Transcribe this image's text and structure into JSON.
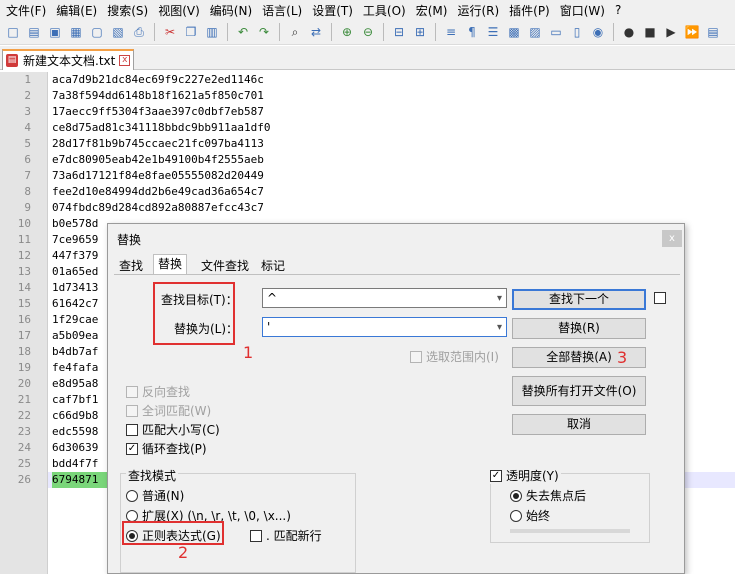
{
  "menu": [
    "文件(F)",
    "编辑(E)",
    "搜索(S)",
    "视图(V)",
    "编码(N)",
    "语言(L)",
    "设置(T)",
    "工具(O)",
    "宏(M)",
    "运行(R)",
    "插件(P)",
    "窗口(W)",
    "?"
  ],
  "tab": {
    "label": "新建文本文档.txt",
    "close": "x"
  },
  "lines": [
    "aca7d9b21dc84ec69f9c227e2ed1146c",
    "7a38f594dd6148b18f1621a5f850c701",
    "17aecc9ff5304f3aae397c0dbf7eb587",
    "ce8d75ad81c341118bbdc9bb911aa1df0",
    "28d17f81b9b745ccaec21fc097ba4113",
    "e7dc80905eab42e1b49100b4f2555aeb",
    "73a6d17121f84e8fae05555082d20449",
    "fee2d10e84994dd2b6e49cad36a654c7",
    "074fbdc89d284cd892a80887efcc43c7",
    "b0e578d",
    "7ce9659",
    "447f379",
    "01a65ed",
    "1d73413",
    "61642c7",
    "1f29cae",
    "a5b09ea",
    "b4db7af",
    "fe4fafa",
    "e8d95a8",
    "caf7bf1",
    "c66d9b8",
    "edc5598",
    "6d30639",
    "bdd4f7f",
    "6794871"
  ],
  "dialog": {
    "title": "替换",
    "close": "x",
    "tabs": [
      "查找",
      "替换",
      "文件查找",
      "标记"
    ],
    "find_label": "查找目标(T)：",
    "find_value": "^",
    "replace_label": "替换为(L)：",
    "replace_value": "'",
    "in_selection": "选取范围内(I)",
    "buttons": {
      "find_next": "查找下一个",
      "replace": "替换(R)",
      "replace_all": "全部替换(A)",
      "replace_all_open": "替换所有打开文件(O)",
      "cancel": "取消"
    },
    "options": {
      "backward": "反向查找",
      "whole_word": "全词匹配(W)",
      "match_case": "匹配大小写(C)",
      "wrap": "循环查找(P)"
    },
    "search_mode": {
      "title": "查找模式",
      "normal": "普通(N)",
      "extended": "扩展(X) (\\n, \\r, \\t, \\0, \\x...)",
      "regex": "正则表达式(G)",
      "dot_newline": ". 匹配新行"
    },
    "transparency": {
      "title": "透明度(Y)",
      "on_lose_focus": "失去焦点后",
      "always": "始终"
    }
  },
  "annotations": [
    "1",
    "2",
    "3"
  ]
}
